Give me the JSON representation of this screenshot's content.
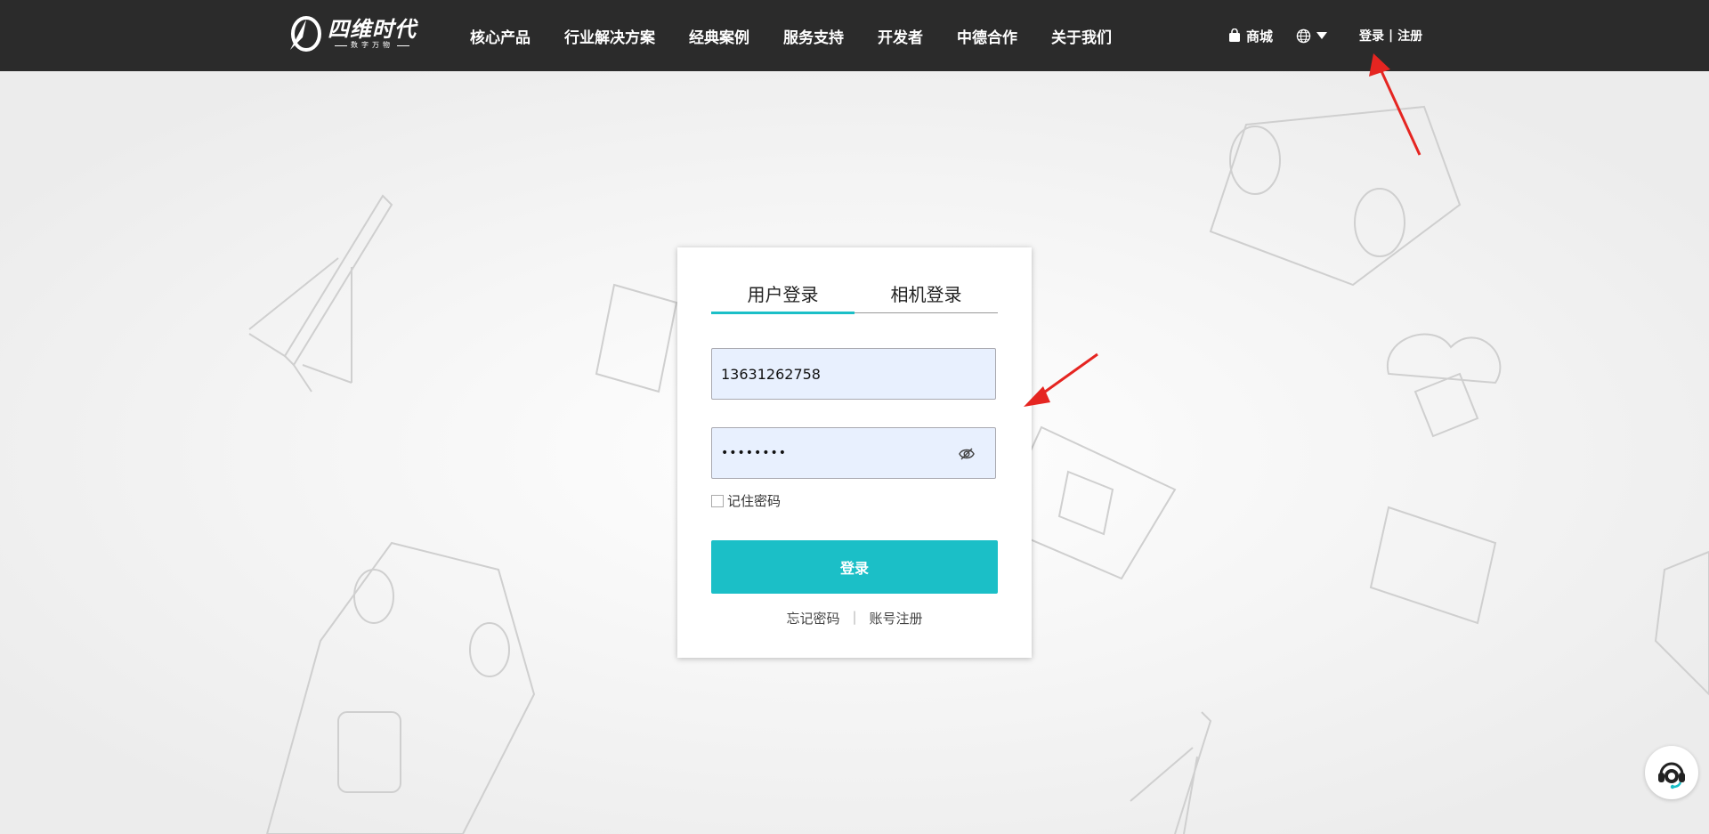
{
  "header": {
    "logo": {
      "title": "四维时代",
      "subtitle": "数字万物"
    },
    "nav": [
      "核心产品",
      "行业解决方案",
      "经典案例",
      "服务支持",
      "开发者",
      "中德合作",
      "关于我们"
    ],
    "shop_label": "商城",
    "login_label": "登录",
    "separator": "|",
    "register_label": "注册"
  },
  "login": {
    "tabs": [
      "用户登录",
      "相机登录"
    ],
    "active_tab": 0,
    "phone_value": "13631262758",
    "password_value": "••••••••",
    "remember_label": "记住密码",
    "remember_checked": false,
    "submit_label": "登录",
    "forgot_label": "忘记密码",
    "divider": "|",
    "register_label": "账号注册"
  },
  "colors": {
    "header_bg": "#2b2b2b",
    "accent": "#1bbfc7",
    "input_bg": "#e8f0fe",
    "annotation": "#e52521"
  },
  "icons": [
    "shopping-bag-icon",
    "globe-icon",
    "chevron-down-icon",
    "eye-off-icon",
    "customer-service-icon"
  ]
}
